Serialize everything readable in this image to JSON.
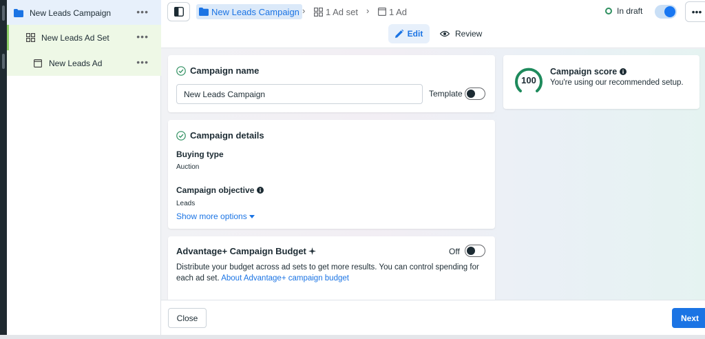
{
  "tree": {
    "campaign": {
      "label": "New Leads Campaign",
      "icon": "folder-icon",
      "more": "•••"
    },
    "adset": {
      "label": "New Leads Ad Set",
      "icon": "grid-icon",
      "more": "•••"
    },
    "ad": {
      "label": "New Leads Ad",
      "icon": "ad-icon",
      "more": "•••"
    }
  },
  "breadcrumb": {
    "campaign": "New Leads Campaign",
    "adset": "1 Ad set",
    "ad": "1 Ad",
    "separator": "›"
  },
  "header": {
    "status": "In draft",
    "status_color": "#2e8f5f",
    "more": "•••",
    "edit_label": "Edit",
    "review_label": "Review"
  },
  "campaign_name": {
    "title": "Campaign name",
    "value": "New Leads Campaign",
    "template_label": "Template"
  },
  "campaign_details": {
    "title": "Campaign details",
    "buying_type_label": "Buying type",
    "buying_type_value": "Auction",
    "objective_label": "Campaign objective",
    "objective_value": "Leads",
    "show_more": "Show more options"
  },
  "budget": {
    "title": "Advantage+ Campaign Budget",
    "toggle_label": "Off",
    "description": "Distribute your budget across ad sets to get more results. You can control spending for each ad set.",
    "link": "About Advantage+ campaign budget"
  },
  "score": {
    "value": "100",
    "title": "Campaign score",
    "subtitle": "You're using our recommended setup."
  },
  "footer": {
    "close": "Close",
    "next": "Next"
  },
  "colors": {
    "accent": "#1b74e4",
    "success": "#2e8f5f"
  }
}
